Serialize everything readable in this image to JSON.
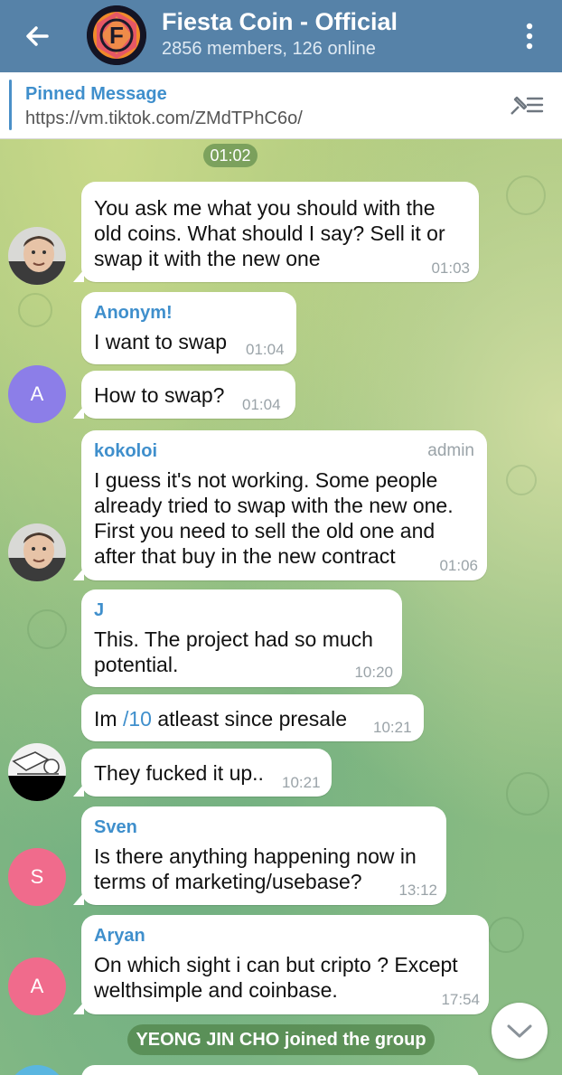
{
  "header": {
    "title": "Fiesta Coin - Official",
    "subtitle": "2856 members, 126 online",
    "avatar_letter": "F"
  },
  "pinned": {
    "label": "Pinned Message",
    "text": "https://vm.tiktok.com/ZMdTPhC6o/"
  },
  "chat": {
    "date_pill": "01:02",
    "messages": [
      {
        "sender": "",
        "lines": [
          "You ask me what you should  with  the",
          "old coins. What should I say?  Sell it or",
          "swap it with the new one"
        ],
        "time": "01:03"
      },
      {
        "sender": "Anonym!",
        "lines": [
          "I want to swap"
        ],
        "time": "01:04"
      },
      {
        "sender": "",
        "lines": [
          "How to swap?"
        ],
        "time": "01:04",
        "avatar_letter": "A"
      },
      {
        "sender": "kokoloi",
        "role": "admin",
        "lines": [
          "I guess  it's not working.  Some people",
          "already tried to swap with the new one.",
          "First you need to sell the old one and",
          "after that buy in the new contract"
        ],
        "time": "01:06"
      },
      {
        "sender": "J",
        "lines": [
          "This. The project had so much",
          "potential."
        ],
        "time": "10:20"
      },
      {
        "sender": "",
        "text_before": "Im ",
        "link": "/10",
        "text_after": " atleast since presale",
        "time": "10:21"
      },
      {
        "sender": "",
        "lines": [
          "They fucked it up.."
        ],
        "time": "10:21"
      },
      {
        "sender": "Sven",
        "lines": [
          "Is there anything happening now in",
          "terms of marketing/usebase?"
        ],
        "time": "13:12",
        "avatar_letter": "S"
      },
      {
        "sender": "Aryan",
        "lines": [
          "On which sight i can but cripto ? Except",
          "welthsimple and coinbase."
        ],
        "time": "17:54",
        "avatar_letter": "A"
      }
    ],
    "service_message": "YEONG JIN CHO joined the group"
  },
  "colors": {
    "header_bg": "#5682a8",
    "link_blue": "#3f8fcc",
    "sender_kokoloi": "#3f8fcc",
    "sender_anonym": "#3f8fcc",
    "sender_j": "#3f8fcc",
    "sender_sven": "#3f8fcc",
    "sender_aryan": "#3f8fcc",
    "avatar_purple": "#8c7ee8",
    "avatar_pink": "#f06b8c"
  },
  "icons": [
    "back-arrow-icon",
    "more-vertical-icon",
    "unpin-list-icon",
    "chevron-down-icon"
  ]
}
